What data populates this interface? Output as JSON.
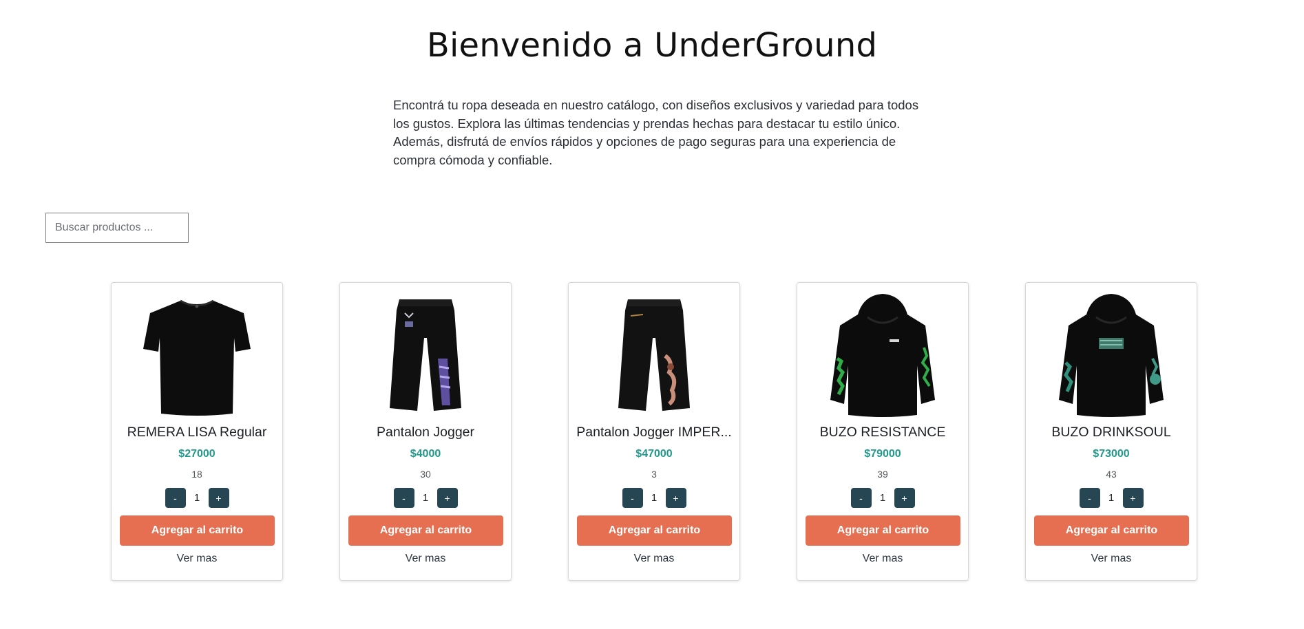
{
  "hero": {
    "title": "Bienvenido a UnderGround",
    "intro": "Encontrá tu ropa deseada en nuestro catálogo, con diseños exclusivos y variedad para todos los gustos. Explora las últimas tendencias y prendas hechas para destacar tu estilo único. Además, disfrutá de envíos rápidos y opciones de pago seguras para una experiencia de compra cómoda y confiable."
  },
  "search": {
    "placeholder": "Buscar productos ...",
    "value": ""
  },
  "colors": {
    "price": "#21998a",
    "qty_button": "#264653",
    "cart_button": "#e76f51"
  },
  "products": [
    {
      "name": "REMERA LISA Regular",
      "price": "$27000",
      "stock": "18",
      "quantity": "1",
      "minus_label": "-",
      "plus_label": "+",
      "cart_label": "Agregar al carrito",
      "more_label": "Ver mas",
      "image_icon": "tshirt-icon"
    },
    {
      "name": "Pantalon Jogger",
      "price": "$4000",
      "stock": "30",
      "quantity": "1",
      "minus_label": "-",
      "plus_label": "+",
      "cart_label": "Agregar al carrito",
      "more_label": "Ver mas",
      "image_icon": "pants-icon"
    },
    {
      "name": "Pantalon Jogger IMPER...",
      "price": "$47000",
      "stock": "3",
      "quantity": "1",
      "minus_label": "-",
      "plus_label": "+",
      "cart_label": "Agregar al carrito",
      "more_label": "Ver mas",
      "image_icon": "pants-icon"
    },
    {
      "name": "BUZO RESISTANCE",
      "price": "$79000",
      "stock": "39",
      "quantity": "1",
      "minus_label": "-",
      "plus_label": "+",
      "cart_label": "Agregar al carrito",
      "more_label": "Ver mas",
      "image_icon": "hoodie-icon"
    },
    {
      "name": "BUZO DRINKSOUL",
      "price": "$73000",
      "stock": "43",
      "quantity": "1",
      "minus_label": "-",
      "plus_label": "+",
      "cart_label": "Agregar al carrito",
      "more_label": "Ver mas",
      "image_icon": "hoodie-icon"
    }
  ]
}
